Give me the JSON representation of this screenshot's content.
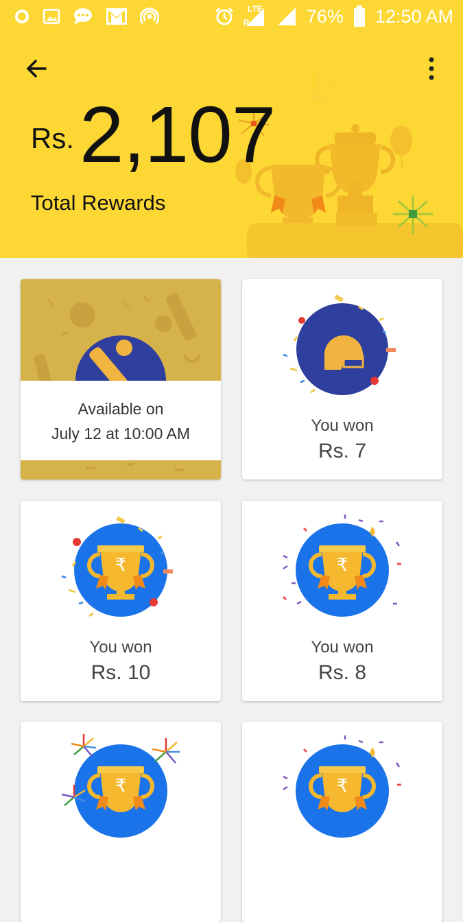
{
  "status_bar": {
    "battery_percent": "76%",
    "time": "12:50 AM",
    "network_label": "LTE",
    "roaming_label": "R",
    "icons": [
      "notification-dot-icon",
      "image-icon",
      "chat-icon",
      "gmail-icon",
      "hotspot-icon",
      "alarm-icon",
      "signal-icon",
      "wifi-signal-icon",
      "battery-icon"
    ]
  },
  "header": {
    "currency_prefix": "Rs.",
    "total_amount": "2,107",
    "total_label": "Total Rewards",
    "back_icon": "arrow-back-icon",
    "menu_icon": "more-vert-icon",
    "background_color": "#fdd835"
  },
  "cards": [
    {
      "type": "locked",
      "line1": "Available on",
      "line2": "July 12 at 10:00 AM",
      "icon": "cricket-bat-ball-icon"
    },
    {
      "type": "won",
      "won_label": "You won",
      "amount": "Rs. 7",
      "icon": "cricket-helmet-icon"
    },
    {
      "type": "won",
      "won_label": "You won",
      "amount": "Rs. 10",
      "icon": "trophy-icon"
    },
    {
      "type": "won",
      "won_label": "You won",
      "amount": "Rs. 8",
      "icon": "trophy-icon"
    },
    {
      "type": "partial",
      "icon": "trophy-icon"
    },
    {
      "type": "partial",
      "icon": "trophy-icon"
    }
  ],
  "colors": {
    "card_badge_dark_blue": "#2f3f9e",
    "card_badge_blue": "#1a73e8",
    "trophy_gold": "#f5b82e",
    "locked_card_bg": "#d6b24b"
  }
}
